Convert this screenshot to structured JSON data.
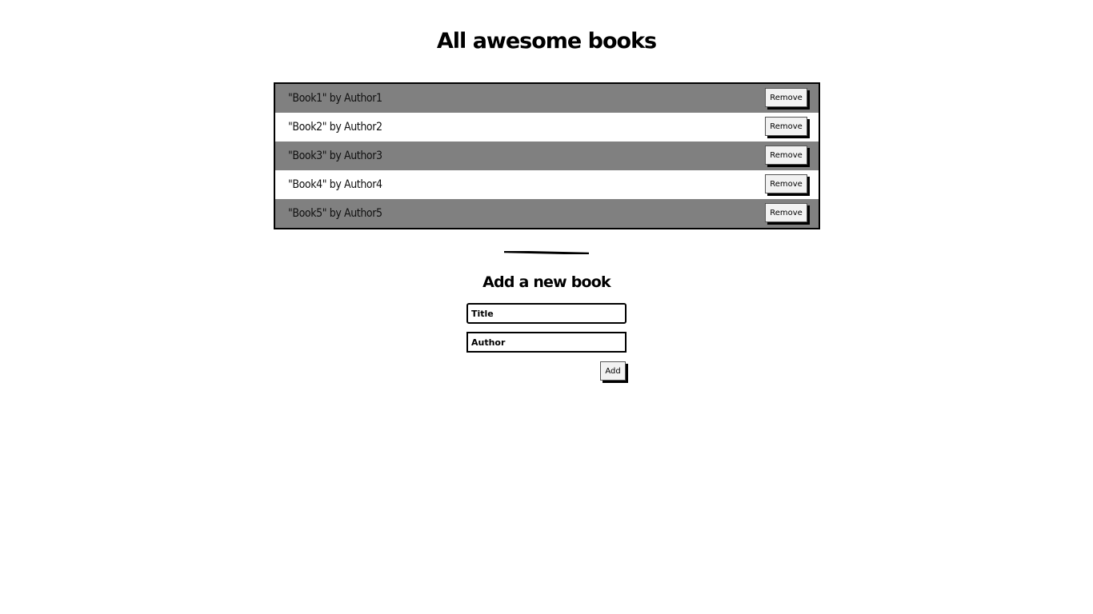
{
  "header": {
    "title": "All awesome books"
  },
  "books": [
    {
      "text": "\"Book1\" by Author1",
      "remove_label": "Remove"
    },
    {
      "text": "\"Book2\" by Author2",
      "remove_label": "Remove"
    },
    {
      "text": "\"Book3\" by Author3",
      "remove_label": "Remove"
    },
    {
      "text": "\"Book4\" by Author4",
      "remove_label": "Remove"
    },
    {
      "text": "\"Book5\" by Author5",
      "remove_label": "Remove"
    }
  ],
  "form": {
    "title": "Add a new book",
    "title_placeholder": "Title",
    "author_placeholder": "Author",
    "add_label": "Add"
  },
  "colors": {
    "odd_row": "#808080",
    "even_row": "#ffffff",
    "border": "#000000"
  }
}
